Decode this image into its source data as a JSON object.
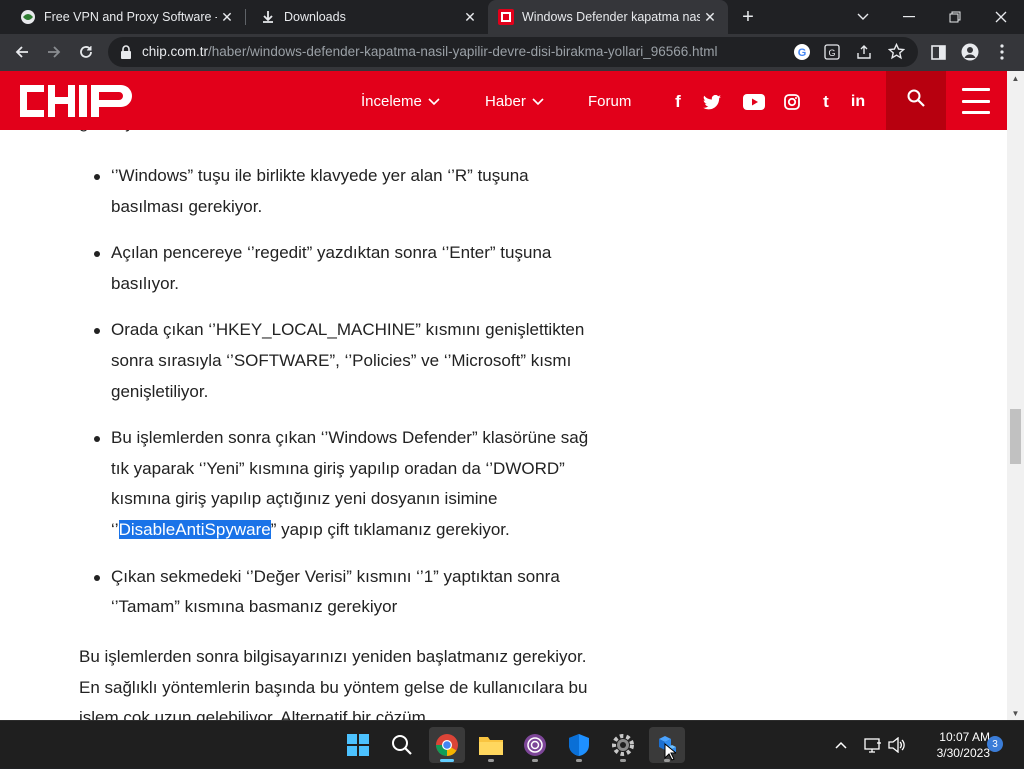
{
  "browser": {
    "tabs": [
      {
        "title": "Free VPN and Proxy Software - D",
        "active": false
      },
      {
        "title": "Downloads",
        "active": false
      },
      {
        "title": "Windows Defender kapatma nası",
        "active": true
      }
    ],
    "new_tab_label": "+",
    "address": {
      "host": "chip.com.tr",
      "path": "/haber/windows-defender-kapatma-nasil-yapilir-devre-disi-birakma-yollari_96566.html"
    }
  },
  "site": {
    "logo_text": "CHIP",
    "brand_color": "#e2001a",
    "nav": [
      {
        "label": "İnceleme",
        "has_dropdown": true
      },
      {
        "label": "Haber",
        "has_dropdown": true
      },
      {
        "label": "Forum",
        "has_dropdown": false
      }
    ],
    "social": [
      "facebook-icon",
      "twitter-icon",
      "youtube-icon",
      "instagram-icon",
      "tumblr-icon",
      "linkedin-icon"
    ]
  },
  "article": {
    "partial_top": "gerekiyor.",
    "steps": [
      {
        "text": "‘’Windows” tuşu ile birlikte klavyede yer alan ‘’R” tuşuna basılması gerekiyor."
      },
      {
        "text": "Açılan pencereye ‘’regedit” yazdıktan sonra ‘’Enter” tuşuna basılıyor."
      },
      {
        "text": "Orada çıkan ‘’HKEY_LOCAL_MACHINE” kısmını genişlettikten sonra sırasıyla ‘’SOFTWARE”, ‘’Policies” ve ‘’Microsoft” kısmı genişletiliyor."
      },
      {
        "text_before": "Bu işlemlerden sonra çıkan ‘’Windows Defender” klasörüne sağ tık yaparak ‘’Yeni” kısmına giriş yapılıp oradan da ‘’DWORD” kısmına giriş yapılıp açtığınız yeni dosyanın isimine ‘’",
        "highlight": "DisableAntiSpyware",
        "text_after": "” yapıp çift tıklamanız gerekiyor."
      },
      {
        "text": "Çıkan sekmedeki ‘’Değer Verisi” kısmını ‘’1” yaptıktan sonra ‘’Tamam” kısmına basmanız gerekiyor"
      }
    ],
    "paragraph": "Bu işlemlerden sonra bilgisayarınızı yeniden başlatmanız gerekiyor. En sağlıklı yöntemlerin başında bu yöntem gelse de kullanıcılara bu işlem çok uzun gelebiliyor. Alternatif bir çözüm"
  },
  "taskbar": {
    "time": "10:07 AM",
    "date": "3/30/2023",
    "notification_count": "3"
  }
}
